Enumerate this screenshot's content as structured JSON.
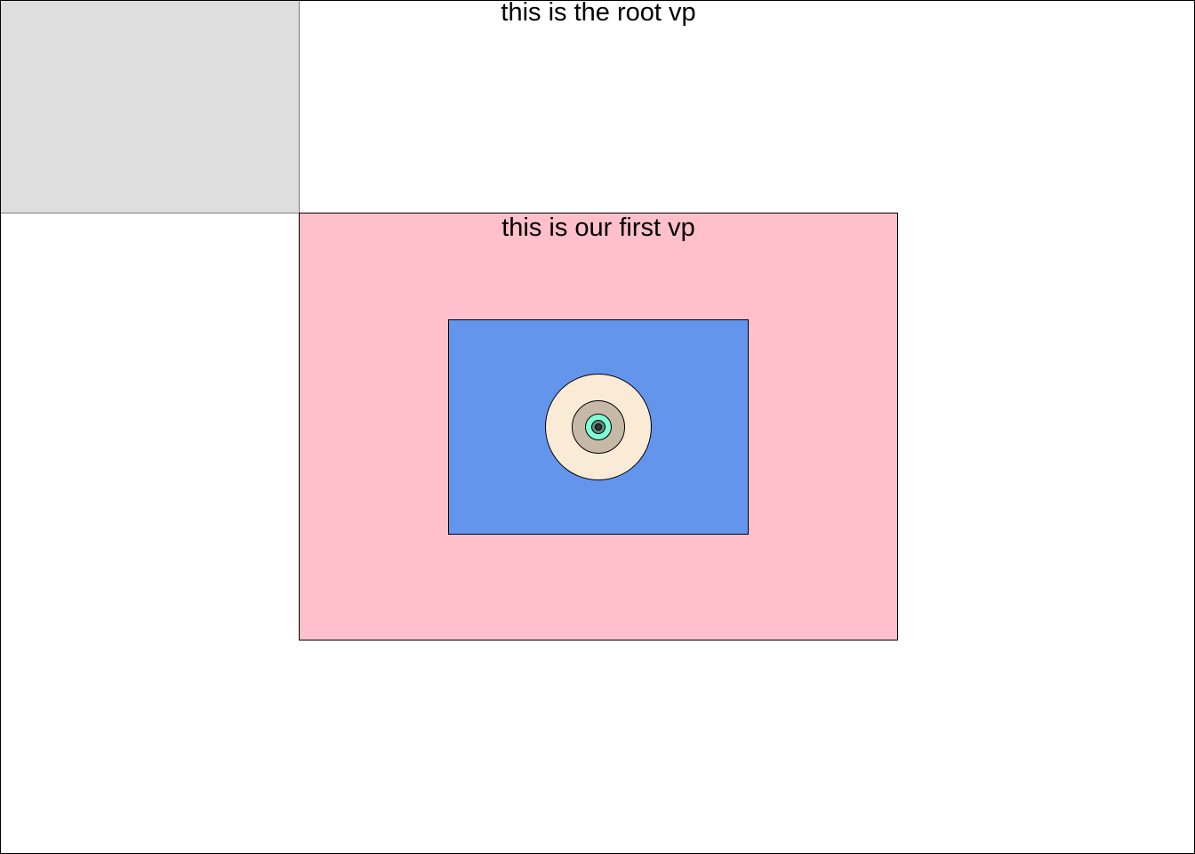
{
  "root_vp": {
    "title": "this is the root vp",
    "background": "#ffffff",
    "corner_fill": "#dedede"
  },
  "first_vp": {
    "title": "this is our first vp",
    "fill": "#ffc0cb"
  },
  "second_vp": {
    "fill": "#6495ed"
  },
  "circles": [
    {
      "fill": "#faebd7"
    },
    {
      "fill": "#c7b9a8"
    },
    {
      "fill": "#7fffd4"
    },
    {
      "fill": "#5f8b7c"
    },
    {
      "fill": "#333333"
    }
  ]
}
